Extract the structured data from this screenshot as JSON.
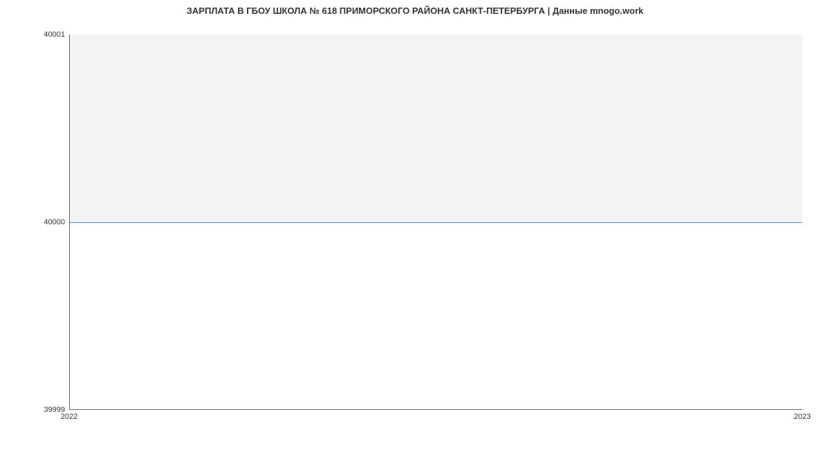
{
  "chart_data": {
    "type": "area",
    "title": "ЗАРПЛАТА В ГБОУ ШКОЛА № 618 ПРИМОРСКОГО РАЙОНА САНКТ-ПЕТЕРБУРГА | Данные mnogo.work",
    "x": [
      "2022",
      "2023"
    ],
    "values": [
      40000,
      40000
    ],
    "xlabel": "",
    "ylabel": "",
    "ylim": [
      39999,
      40001
    ],
    "y_ticks": [
      "39999",
      "40000",
      "40001"
    ],
    "x_ticks": [
      "2022",
      "2023"
    ],
    "line_color": "#5a8fd6",
    "fill_color": "#f3f3f3"
  }
}
